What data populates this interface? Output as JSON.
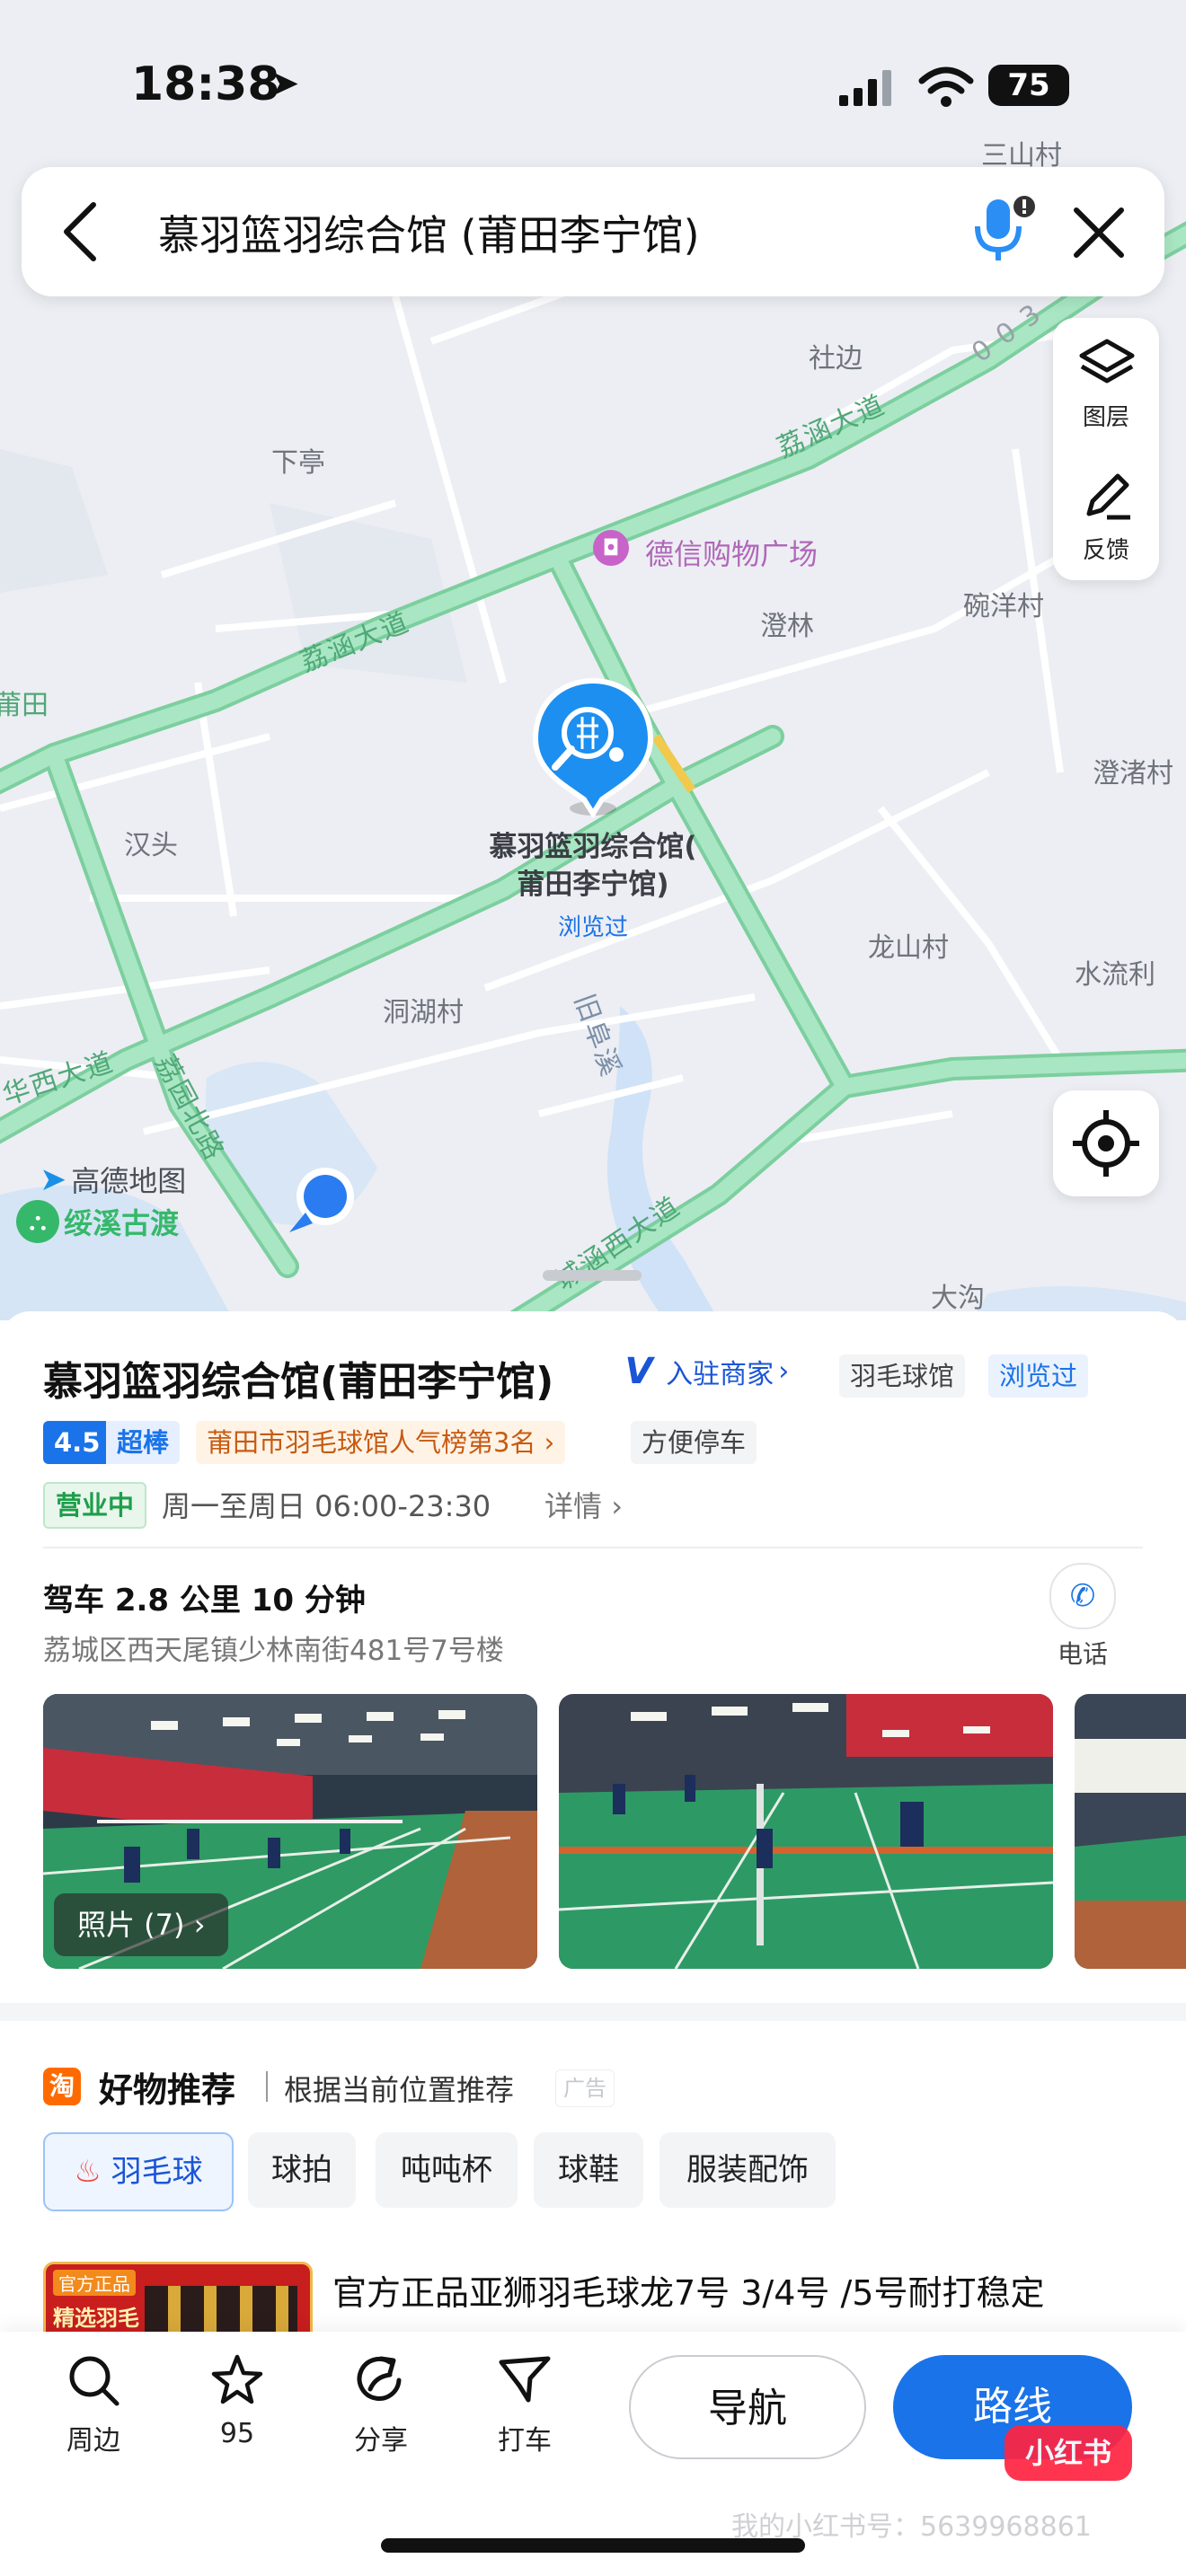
{
  "status_bar": {
    "time": "18:38",
    "battery": "75"
  },
  "search": {
    "query": "慕羽篮羽综合馆 (莆田李宁馆)"
  },
  "map_tools": {
    "layers_label": "图层",
    "feedback_label": "反馈"
  },
  "map": {
    "places": [
      "三山村",
      "社边",
      "下亭",
      "德信购物广场",
      "澄林",
      "碗洋村",
      "澄渚村",
      "汉头",
      "洞湖村",
      "龙山村",
      "水流利",
      "大沟",
      "莆田",
      "绥溪古渡"
    ],
    "roads": [
      "荔涵大道",
      "荔涵大道",
      "华西大道",
      "荔园北路",
      "旧阜溪",
      "城涵西大道"
    ],
    "road_codes": [
      "003"
    ],
    "pin_name_line1": "慕羽篮羽综合馆(",
    "pin_name_line2": "莆田李宁馆)",
    "pin_visited": "浏览过",
    "logo_text": "高德地图"
  },
  "poi": {
    "name": "慕羽篮羽综合馆(莆田李宁馆)",
    "merchant_badge": "入驻商家",
    "category": "羽毛球馆",
    "visited": "浏览过",
    "rating": "4.5",
    "rating_label": "超棒",
    "ranking": "莆田市羽毛球馆人气榜第3名",
    "parking": "方便停车",
    "open_status": "营业中",
    "hours": "周一至周日 06:00-23:30",
    "details_link": "详情",
    "drive_info": "驾车 2.8 公里 10 分钟",
    "address": "荔城区西天尾镇少林南街481号7号楼",
    "phone_label": "电话",
    "photos_label": "照片 (7)"
  },
  "recommend": {
    "badge": "淘",
    "title": "好物推荐",
    "subtitle": "根据当前位置推荐",
    "ad_label": "广告",
    "chips": [
      "羽毛球",
      "球拍",
      "吨吨杯",
      "球鞋",
      "服装配饰"
    ],
    "product_title": "官方正品亚狮羽毛球龙7号 3/4号 /5号耐打稳定",
    "product_badge_1": "官方正品",
    "product_badge_2": "精选羽毛"
  },
  "tabbar": {
    "nearby": "周边",
    "favorites_count": "95",
    "share": "分享",
    "taxi": "打车",
    "navigate": "导航",
    "route": "路线"
  },
  "watermark": {
    "brand": "小红书",
    "id_text": "我的小红书号：5639968861"
  },
  "colors": {
    "road": "#9edfb9",
    "road_edge": "#7ccf9e",
    "accent_blue": "#1a73e8",
    "pin_blue": "#1d8ff0",
    "open_green": "#1e9e4a",
    "rank_orange": "#c75b12"
  }
}
